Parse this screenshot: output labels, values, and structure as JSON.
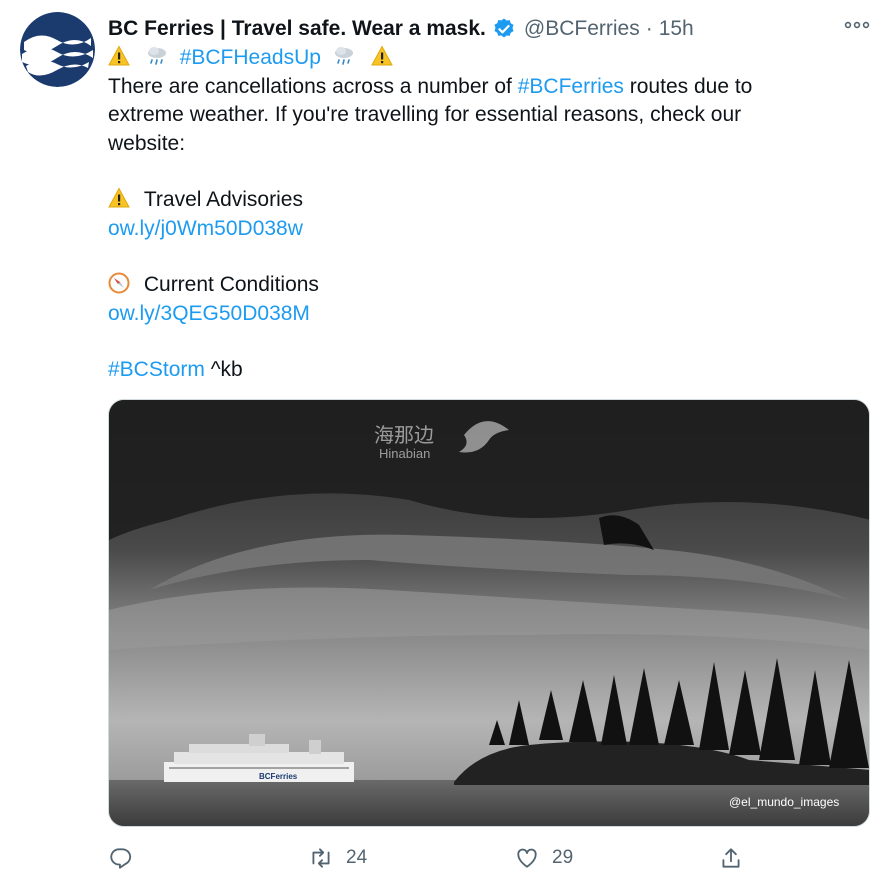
{
  "tweet": {
    "display_name": "BC Ferries | Travel safe. Wear a mask.",
    "handle": "@BCFerries",
    "separator": "·",
    "time": "15h",
    "hashtag_heads_up": "#BCFHeadsUp",
    "text_line1_pre": "There are cancellations across a number of ",
    "text_line1_tag": "#BCFerries",
    "text_line1_post": " routes due to",
    "text_line2": "extreme weather. If you're travelling for essential reasons, check our",
    "text_line3": "website:",
    "advisories_label": "Travel Advisories",
    "advisories_link": "ow.ly/j0Wm50D038w",
    "conditions_label": "Current Conditions",
    "conditions_link": "ow.ly/3QEG50D038M",
    "storm_tag": "#BCStorm",
    "signature": " ^kb"
  },
  "media": {
    "watermark_cn": "海那边",
    "watermark_en": "Hinabian",
    "credit": "@el_mundo_images",
    "ferry_label": "BCFerries"
  },
  "actions": {
    "reply_count": "",
    "retweet_count": "24",
    "like_count": "29"
  },
  "icons": [
    "warning-icon",
    "cloud-rain-icon",
    "compass-icon",
    "verified-badge-icon",
    "more-icon",
    "reply-icon",
    "retweet-icon",
    "like-icon",
    "share-icon"
  ],
  "colors": {
    "link": "#1d9bf0",
    "muted": "#536471",
    "brand": "#1b3b6f"
  }
}
